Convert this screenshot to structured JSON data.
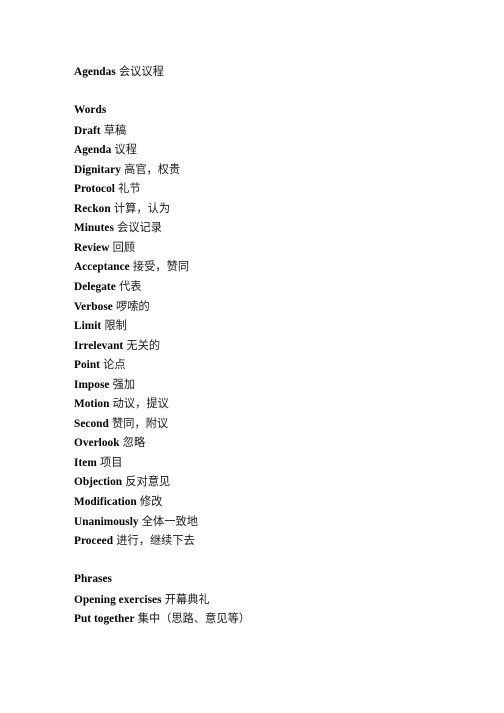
{
  "document": {
    "title_line": {
      "term": "Agendas",
      "gloss": "会议议程"
    },
    "sections": [
      {
        "heading": "Words",
        "entries": [
          {
            "term": "Draft",
            "gloss": "草稿"
          },
          {
            "term": "Agenda",
            "gloss": "议程"
          },
          {
            "term": "Dignitary",
            "gloss": "高官，权贵"
          },
          {
            "term": "Protocol",
            "gloss": "礼节"
          },
          {
            "term": "Reckon",
            "gloss": "计算，认为"
          },
          {
            "term": "Minutes",
            "gloss": "会议记录"
          },
          {
            "term": "Review",
            "gloss": "回顾"
          },
          {
            "term": "Acceptance",
            "gloss": "接受，赞同"
          },
          {
            "term": "Delegate",
            "gloss": "代表"
          },
          {
            "term": "Verbose",
            "gloss": "啰嗦的"
          },
          {
            "term": "Limit",
            "gloss": "限制"
          },
          {
            "term": "Irrelevant",
            "gloss": "无关的"
          },
          {
            "term": "Point",
            "gloss": "论点"
          },
          {
            "term": "Impose",
            "gloss": "强加"
          },
          {
            "term": "Motion",
            "gloss": "动议，提议"
          },
          {
            "term": "Second",
            "gloss": "赞同，附议"
          },
          {
            "term": "Overlook",
            "gloss": "忽略"
          },
          {
            "term": "Item",
            "gloss": "项目"
          },
          {
            "term": "Objection",
            "gloss": "反对意见"
          },
          {
            "term": "Modification",
            "gloss": "修改"
          },
          {
            "term": "Unanimously",
            "gloss": "全体一致地"
          },
          {
            "term": "Proceed",
            "gloss": "进行，继续下去"
          }
        ]
      },
      {
        "heading": "Phrases",
        "entries": [
          {
            "term": "Opening exercises",
            "gloss": "开幕典礼"
          },
          {
            "term": "Put together",
            "gloss": "集中（思路、意见等）"
          }
        ]
      }
    ]
  },
  "style": {
    "background_color": "#ffffff",
    "text_color": "#000000",
    "gloss_color": "#1a1a1a"
  }
}
